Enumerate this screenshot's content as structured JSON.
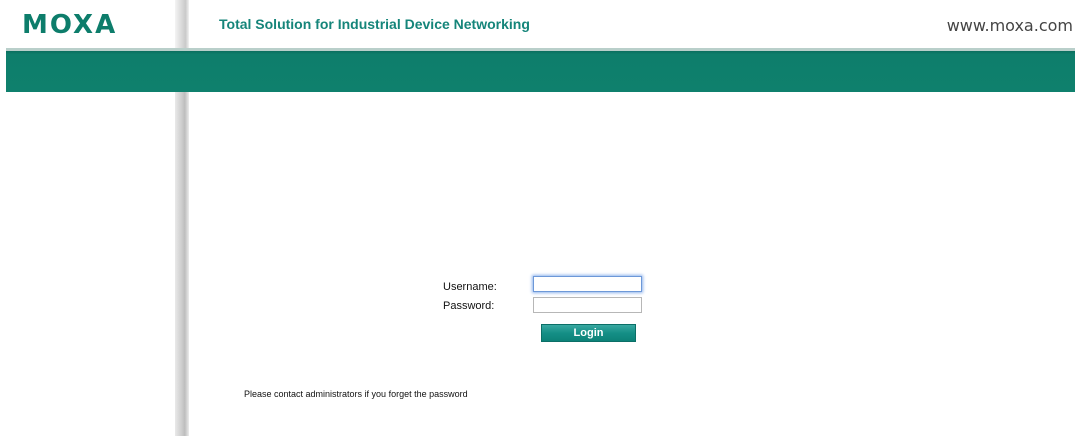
{
  "header": {
    "logo_text": "MOXA",
    "logo_mark": "®",
    "tagline": "Total Solution for Industrial Device Networking",
    "site_url": "www.moxa.com"
  },
  "login_form": {
    "username_label": "Username:",
    "password_label": "Password:",
    "username_value": "",
    "password_value": "",
    "login_button": "Login"
  },
  "footer_notice": "Please contact administrators if you forget the password",
  "colors": {
    "brand_green": "#0d7d6b",
    "banner_green": "#0f806d",
    "button_teal": "#158f86",
    "focus_ring": "#8fb3ec"
  }
}
